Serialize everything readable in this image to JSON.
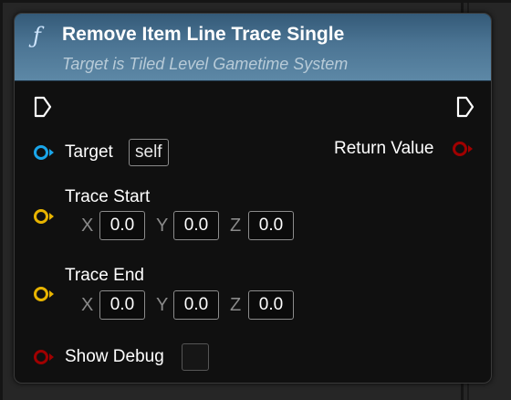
{
  "node": {
    "icon": "function-icon",
    "title": "Remove Item Line Trace Single",
    "subtitle": "Target is Tiled Level Gametime System",
    "func_glyph": "ƒ"
  },
  "pins": {
    "target": {
      "label": "Target",
      "value": "self",
      "color": "#1aa6ea"
    },
    "return_value": {
      "label": "Return Value",
      "color": "#a00000"
    },
    "trace_start": {
      "label": "Trace Start",
      "color": "#e8b400",
      "x": {
        "axis": "X",
        "value": "0.0"
      },
      "y": {
        "axis": "Y",
        "value": "0.0"
      },
      "z": {
        "axis": "Z",
        "value": "0.0"
      }
    },
    "trace_end": {
      "label": "Trace End",
      "color": "#e8b400",
      "x": {
        "axis": "X",
        "value": "0.0"
      },
      "y": {
        "axis": "Y",
        "value": "0.0"
      },
      "z": {
        "axis": "Z",
        "value": "0.0"
      }
    },
    "show_debug": {
      "label": "Show Debug",
      "color": "#a00000",
      "checked": false
    }
  },
  "colors": {
    "header_top": "#345a78",
    "header_bottom": "#5d88a6",
    "node_body": "#101010",
    "canvas": "#262626"
  }
}
